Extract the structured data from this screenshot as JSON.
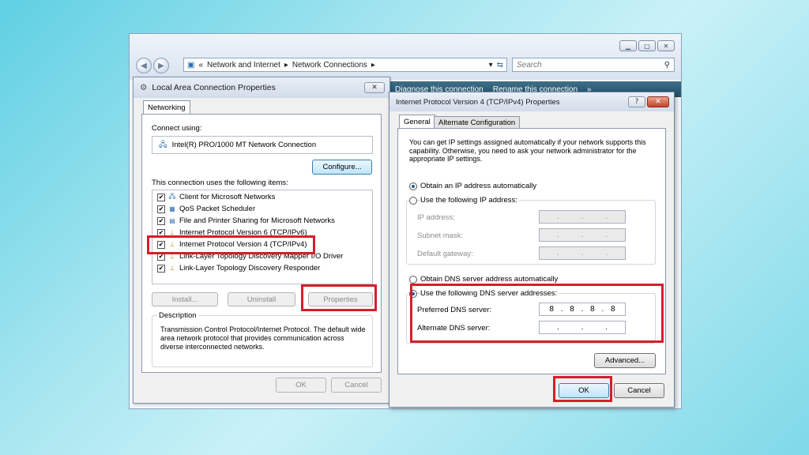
{
  "explorer": {
    "address_prefix": "«",
    "breadcrumb_1": "Network and Internet",
    "sep": "▸",
    "breadcrumb_2": "Network Connections",
    "search_placeholder": "Search",
    "cmd_diagnose": "Diagnose this connection",
    "cmd_rename": "Rename this connection",
    "cmd_more": "»"
  },
  "lan": {
    "title": "Local Area Connection Properties",
    "tab": "Networking",
    "connect_using_label": "Connect using:",
    "adapter": "Intel(R) PRO/1000 MT Network Connection",
    "configure": "Configure...",
    "items_label": "This connection uses the following items:",
    "items": [
      {
        "label": "Client for Microsoft Networks",
        "icon": "network-client-icon"
      },
      {
        "label": "QoS Packet Scheduler",
        "icon": "qos-icon"
      },
      {
        "label": "File and Printer Sharing for Microsoft Networks",
        "icon": "file-printer-icon"
      },
      {
        "label": "Internet Protocol Version 6 (TCP/IPv6)",
        "icon": "protocol-icon"
      },
      {
        "label": "Internet Protocol Version 4 (TCP/IPv4)",
        "icon": "protocol-icon"
      },
      {
        "label": "Link-Layer Topology Discovery Mapper I/O Driver",
        "icon": "protocol-icon"
      },
      {
        "label": "Link-Layer Topology Discovery Responder",
        "icon": "protocol-icon"
      }
    ],
    "install": "Install...",
    "uninstall": "Uninstall",
    "properties": "Properties",
    "description_label": "Description",
    "description_text": "Transmission Control Protocol/Internet Protocol. The default wide area network protocol that provides communication across diverse interconnected networks.",
    "ok": "OK",
    "cancel": "Cancel"
  },
  "ipv4": {
    "title": "Internet Protocol Version 4 (TCP/IPv4) Properties",
    "help": "?",
    "tab_general": "General",
    "tab_alt": "Alternate Configuration",
    "intro": "You can get IP settings assigned automatically if your network supports this capability. Otherwise, you need to ask your network administrator for the appropriate IP settings.",
    "obtain_ip_auto": "Obtain an IP address automatically",
    "use_following_ip": "Use the following IP address:",
    "ip_address_label": "IP address:",
    "subnet_label": "Subnet mask:",
    "gateway_label": "Default gateway:",
    "obtain_dns_auto": "Obtain DNS server address automatically",
    "use_following_dns": "Use the following DNS server addresses:",
    "preferred_dns_label": "Preferred DNS server:",
    "preferred_dns": [
      "8",
      "8",
      "8",
      "8"
    ],
    "alternate_dns_label": "Alternate DNS server:",
    "advanced": "Advanced...",
    "ok": "OK",
    "cancel": "Cancel"
  },
  "colors": {
    "highlight": "#d51f2b",
    "cmdbar": "#2b5b74"
  }
}
